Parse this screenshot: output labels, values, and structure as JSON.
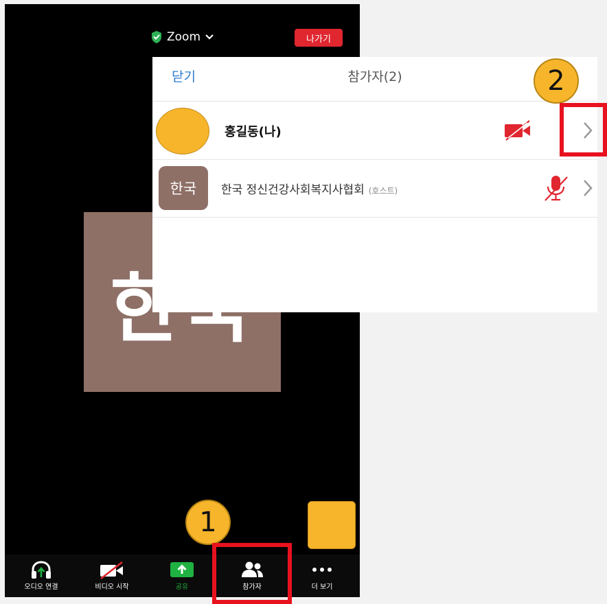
{
  "app": {
    "title": "Zoom",
    "leave_label": "나가기",
    "video_tile_text": "한국"
  },
  "toolbar": {
    "items": [
      {
        "label": "오디오 연결",
        "icon": "headphones-icon"
      },
      {
        "label": "비디오 시작",
        "icon": "video-off-icon"
      },
      {
        "label": "공유",
        "icon": "share-icon"
      },
      {
        "label": "참가자",
        "icon": "participants-icon"
      },
      {
        "label": "더 보기",
        "icon": "more-icon"
      }
    ]
  },
  "participants_panel": {
    "close_label": "닫기",
    "title": "참가자(2)",
    "participants": [
      {
        "name": "홍길동(나)",
        "avatar_text": "",
        "status_icon": "video-off-icon"
      },
      {
        "name": "한국 정신건강사회복지사협회",
        "tag": "(호스트)",
        "avatar_text": "한국",
        "status_icon": "mic-off-icon"
      }
    ]
  },
  "annotations": {
    "badge1": "1",
    "badge2": "2"
  },
  "colors": {
    "leave_red": "#e0262f",
    "accent_blue": "#2d7ad0",
    "annotation_red": "#e8121f",
    "badge_yellow": "#f7b52b",
    "avatar_brown": "#8e7067",
    "share_green": "#1fb141"
  }
}
